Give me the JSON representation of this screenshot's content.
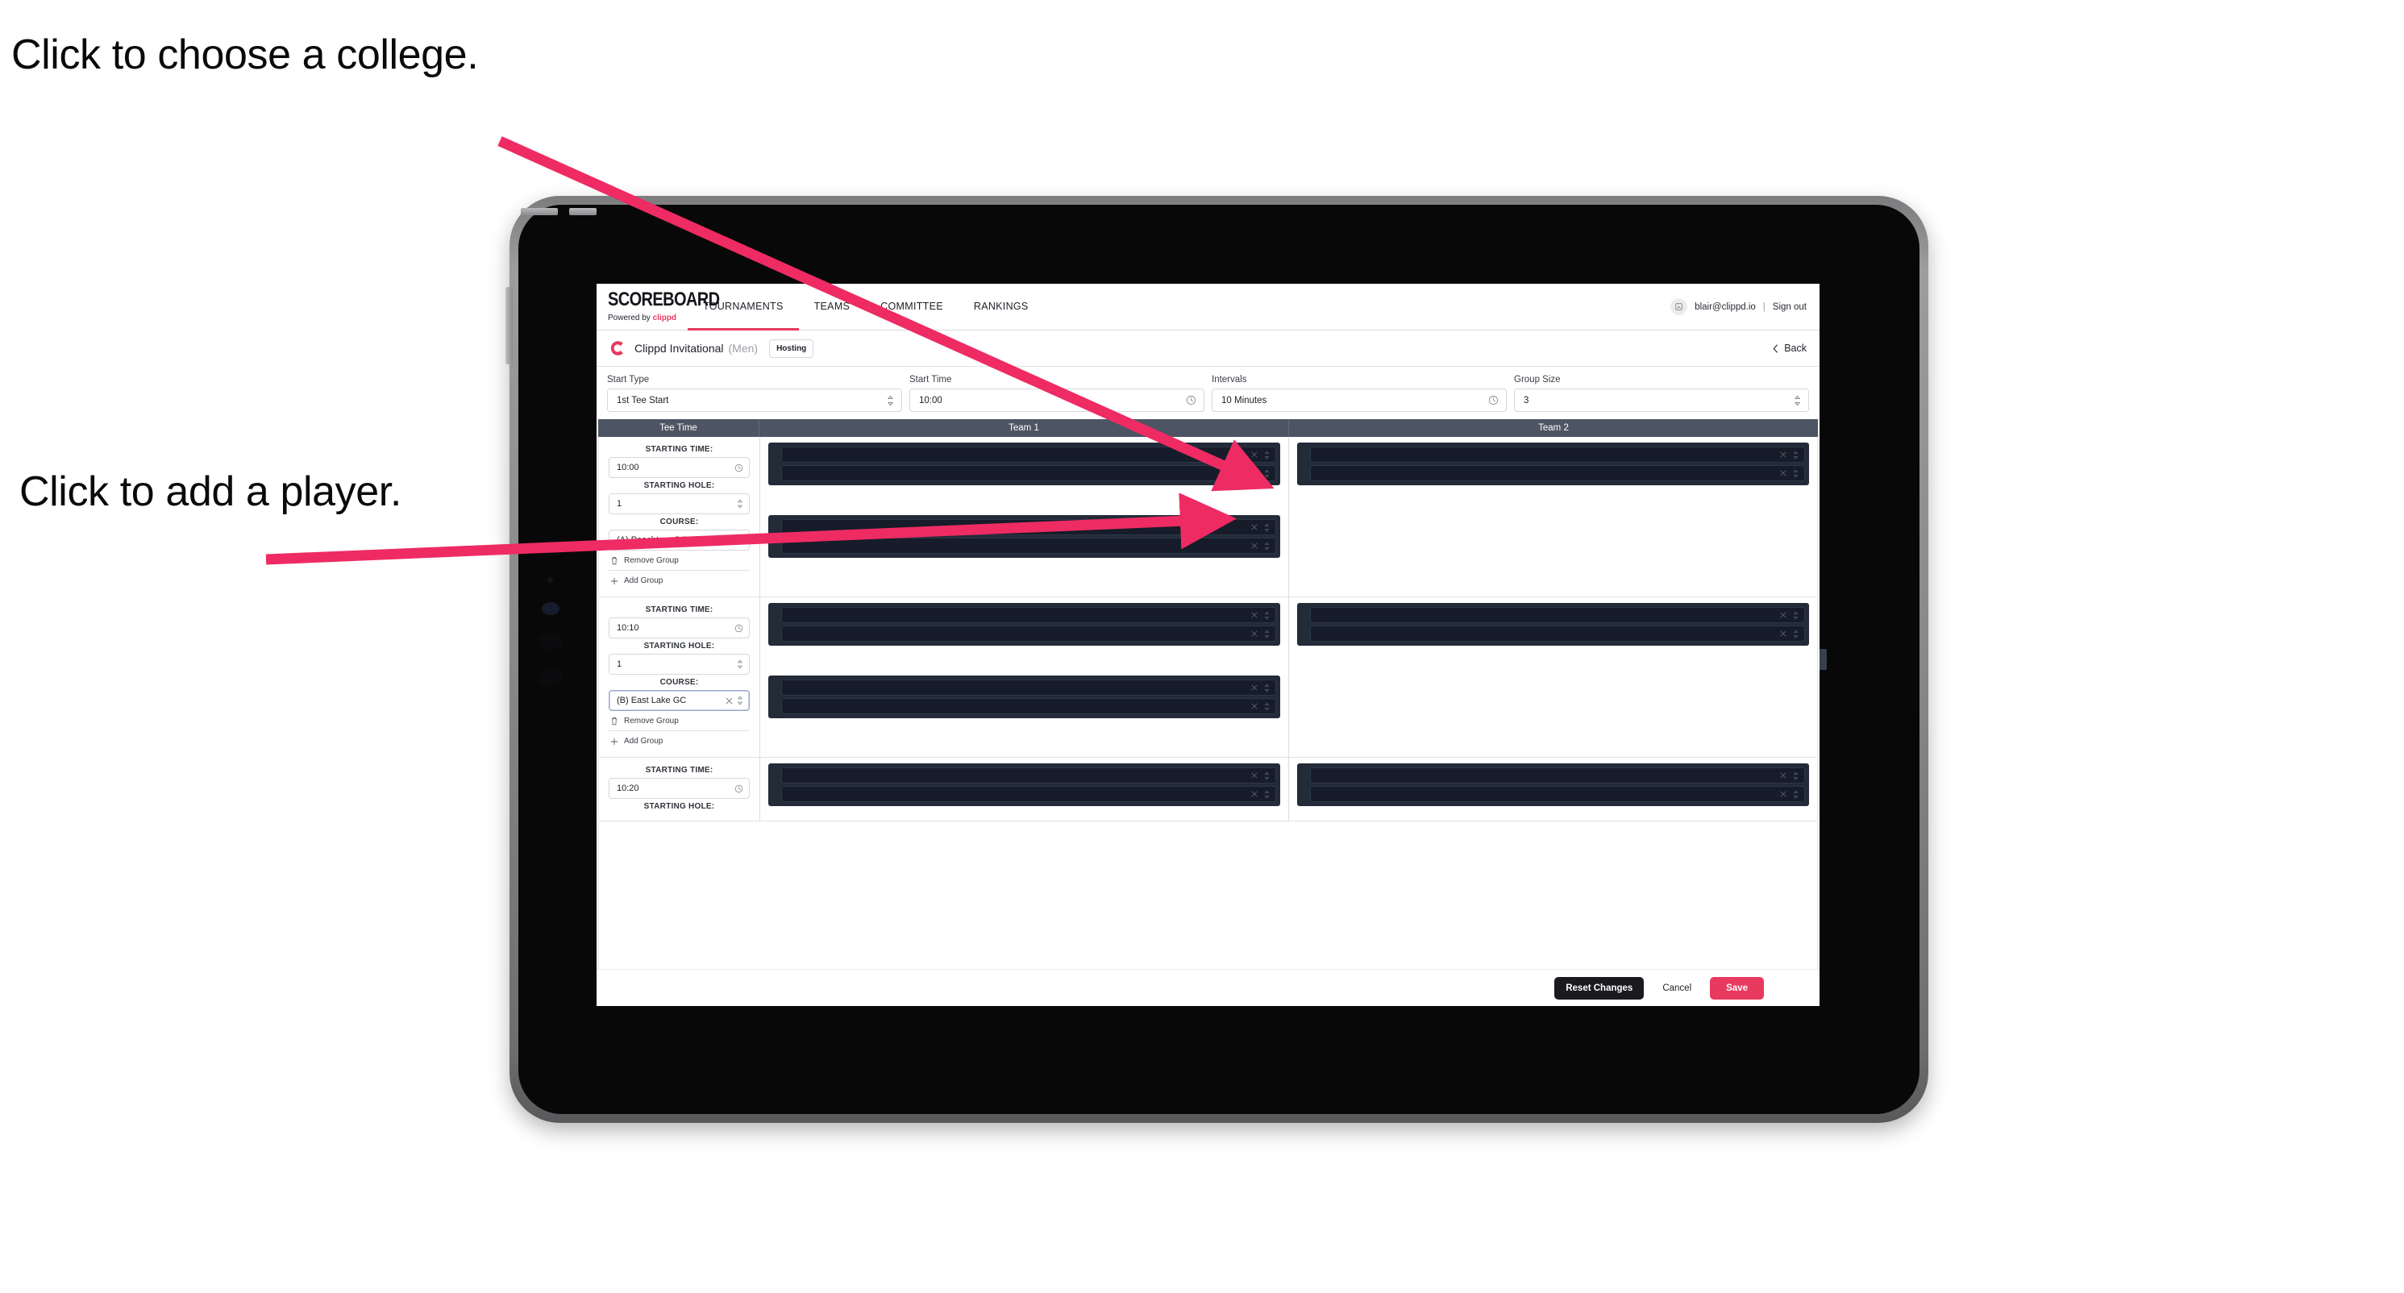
{
  "annotations": [
    {
      "id": "college",
      "text": "Click to choose a college."
    },
    {
      "id": "player",
      "text": "Click to add a player."
    }
  ],
  "colors": {
    "accent": "#e8395f",
    "annotation_arrow": "#e8395f",
    "table_header_bg": "#4d5463",
    "player_pod_bg": "#232a38",
    "player_row_bg": "#161c29",
    "save_button_bg": "#e8395f",
    "reset_button_bg": "#1b1b1f"
  },
  "topnav": {
    "brand_title": "SCOREBOARD",
    "brand_sub_prefix": "Powered by ",
    "brand_sub_accent": "clippd",
    "tabs": [
      {
        "label": "TOURNAMENTS",
        "active": true
      },
      {
        "label": "TEAMS",
        "active": false
      },
      {
        "label": "COMMITTEE",
        "active": false
      },
      {
        "label": "RANKINGS",
        "active": false
      }
    ],
    "avatar_icon": "user-icon",
    "user_email": "blair@clippd.io",
    "separator": "|",
    "signout_label": "Sign out"
  },
  "tournament_bar": {
    "logo_icon": "clippd-c-logo-icon",
    "name": "Clippd Invitational",
    "gender": "(Men)",
    "badge": "Hosting",
    "back_label": "Back",
    "back_icon": "chevron-left-icon"
  },
  "settings": [
    {
      "label": "Start Type",
      "value": "1st Tee Start",
      "icon": "stepper-icon"
    },
    {
      "label": "Start Time",
      "value": "10:00",
      "icon": "clock-icon"
    },
    {
      "label": "Intervals",
      "value": "10 Minutes",
      "icon": "clock-icon"
    },
    {
      "label": "Group Size",
      "value": "3",
      "icon": "stepper-icon"
    }
  ],
  "table": {
    "headers": {
      "tee_time": "Tee Time",
      "team1": "Team 1",
      "team2": "Team 2"
    },
    "labels": {
      "starting_time": "STARTING TIME:",
      "starting_hole": "STARTING HOLE:",
      "course": "COURSE:",
      "remove_group": "Remove Group",
      "add_group": "Add Group",
      "remove_icon": "trash-icon",
      "add_icon": "plus-icon",
      "clock_icon": "clock-icon",
      "stepper_icon": "stepper-icon",
      "clear_icon": "close-x-icon"
    },
    "groups": [
      {
        "starting_time": "10:00",
        "starting_hole": "1",
        "course": "(A) Peachtree GC",
        "course_focused": false,
        "team1_pods": [
          {
            "rows": 2
          },
          {
            "rows": 2
          }
        ],
        "team2_pods": [
          {
            "rows": 2
          }
        ]
      },
      {
        "starting_time": "10:10",
        "starting_hole": "1",
        "course": "(B) East Lake GC",
        "course_focused": true,
        "team1_pods": [
          {
            "rows": 2
          },
          {
            "rows": 2
          }
        ],
        "team2_pods": [
          {
            "rows": 2
          }
        ]
      },
      {
        "starting_time": "10:20",
        "starting_hole": "",
        "course": "",
        "course_focused": false,
        "team1_pods": [
          {
            "rows": 2
          }
        ],
        "team2_pods": [
          {
            "rows": 2
          }
        ]
      }
    ]
  },
  "footer": {
    "reset_label": "Reset Changes",
    "cancel_label": "Cancel",
    "save_label": "Save"
  }
}
